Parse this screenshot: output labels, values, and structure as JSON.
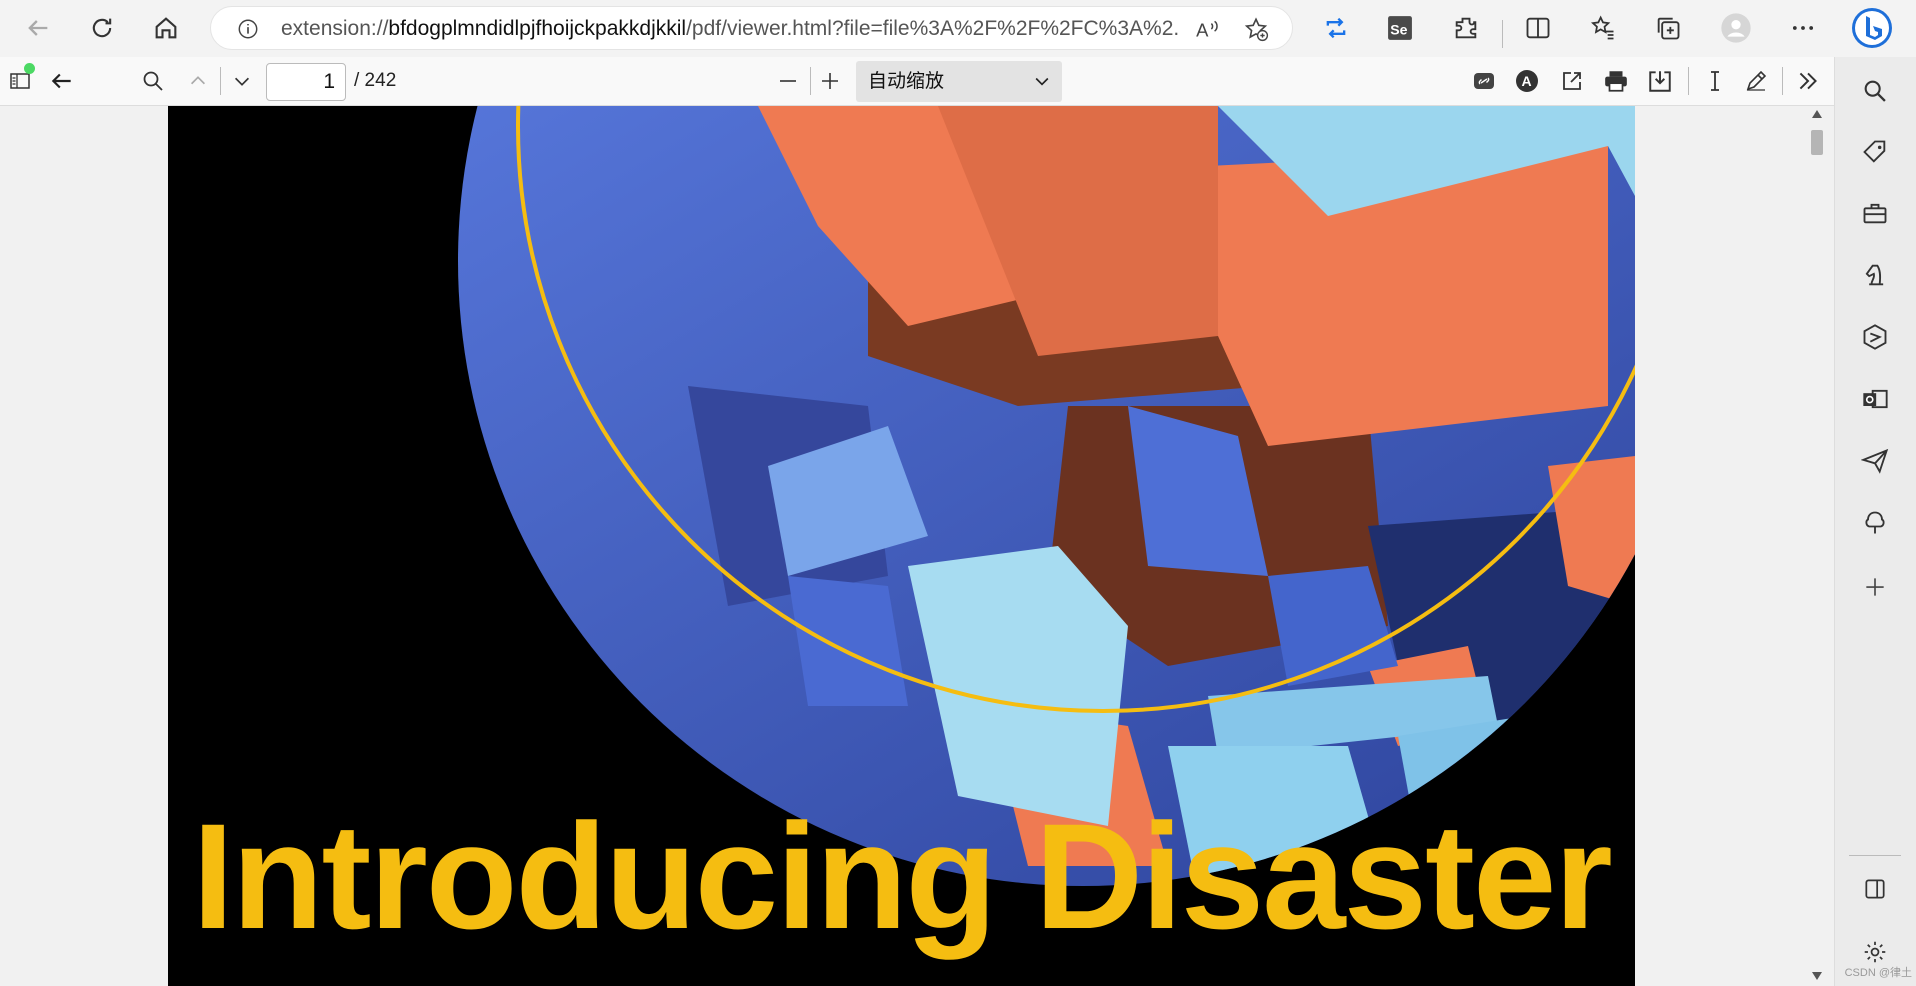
{
  "browser": {
    "url_prefix": "extension://",
    "url_host": "bfdogplmndidlpjfhoijckpakkdjkkil",
    "url_rest": "/pdf/viewer.html?file=file%3A%2F%2F%2FC%3A%2..."
  },
  "pdf_toolbar": {
    "current_page": "1",
    "page_total": "/ 242",
    "zoom_value": "自动缩放"
  },
  "document": {
    "cover_title": "Introducing Disaster"
  },
  "watermark": "CSDN @律土",
  "colors": {
    "title_yellow": "#f5bd11",
    "orange": "#ef7a52",
    "blue": "#3d5ab8",
    "sky": "#9bd6ee",
    "edge_accent": "#1a73e8"
  },
  "icons": {
    "back": "back-arrow-icon",
    "refresh": "refresh-icon",
    "home": "home-icon",
    "info": "info-icon",
    "read_aloud": "read-aloud-icon",
    "favorite_add": "star-add-icon",
    "bing": "bing-icon"
  }
}
